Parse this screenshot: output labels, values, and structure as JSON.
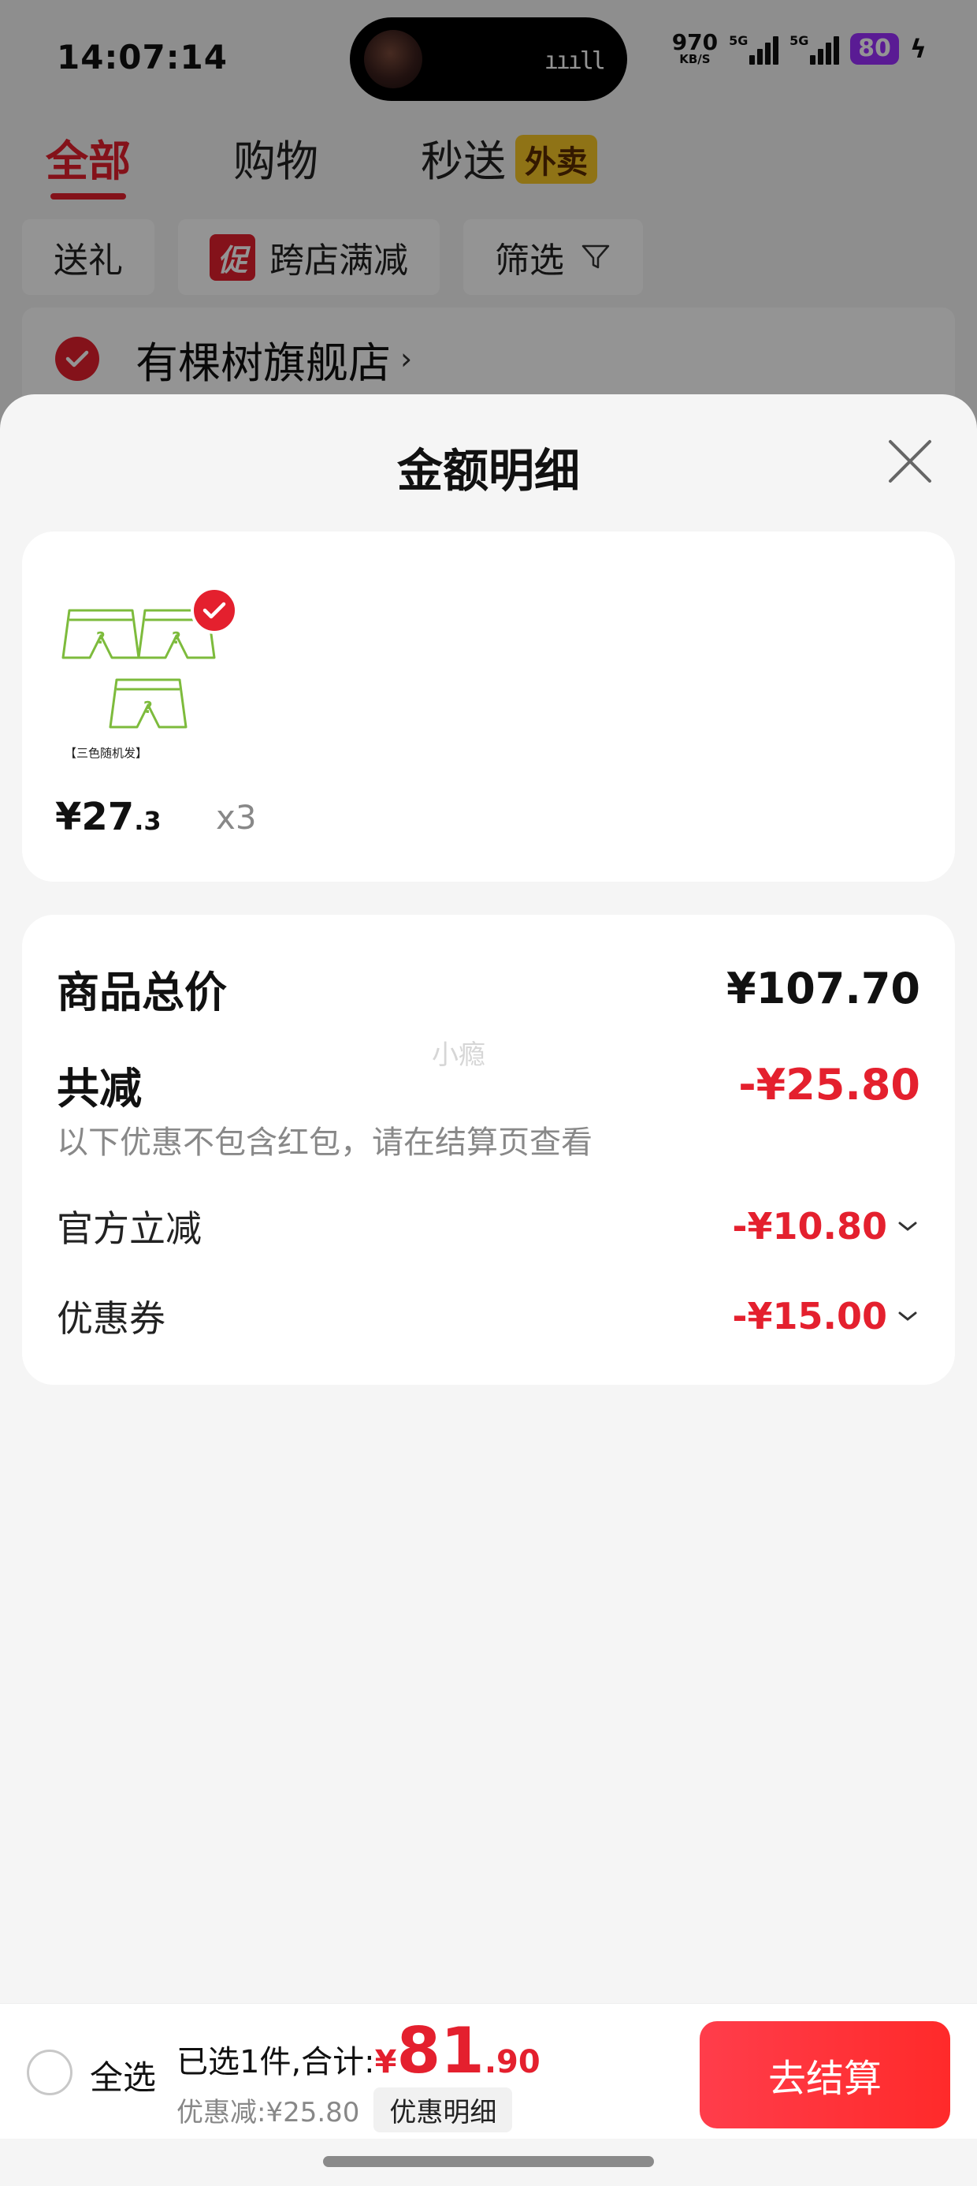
{
  "status_bar": {
    "time": "14:07:14",
    "net_speed": "970",
    "net_unit": "KB/S",
    "sim1_label": "5G",
    "sim2_label": "5G",
    "battery": "80"
  },
  "background": {
    "tabs": [
      {
        "label": "全部",
        "active": true
      },
      {
        "label": "购物",
        "active": false
      },
      {
        "label": "秒送",
        "active": false,
        "badge": "外卖"
      }
    ],
    "filters": {
      "gift": "送礼",
      "promo_badge": "促",
      "cross_store": "跨店满减",
      "filter": "筛选"
    },
    "store_name": "有棵树旗舰店",
    "store_arrow": "›"
  },
  "sheet": {
    "title": "金额明细",
    "product": {
      "image_caption": "【三色随机发】",
      "price_main": "¥27",
      "price_dec": ".3",
      "quantity": "x3"
    },
    "summary": {
      "total_label": "商品总价",
      "total_value": "¥107.70",
      "reduce_label": "共减",
      "reduce_value": "-¥25.80",
      "note": "以下优惠不包含红包，请在结算页查看",
      "watermark": "小瘾",
      "items": [
        {
          "label": "官方立减",
          "value": "-¥10.80"
        },
        {
          "label": "优惠券",
          "value": "-¥15.00"
        }
      ]
    }
  },
  "bottom_bar": {
    "select_all": "全选",
    "total_prefix": "已选1件,合计:",
    "currency": "¥",
    "total_int": "81",
    "total_dec": ".90",
    "discount": "优惠减:¥25.80",
    "detail_button": "优惠明细",
    "checkout": "去结算"
  },
  "colors": {
    "accent_red": "#e4202e",
    "badge_yellow": "#f6c727",
    "battery_purple": "#9b30ff",
    "product_outline_green": "#7dbb3c"
  }
}
